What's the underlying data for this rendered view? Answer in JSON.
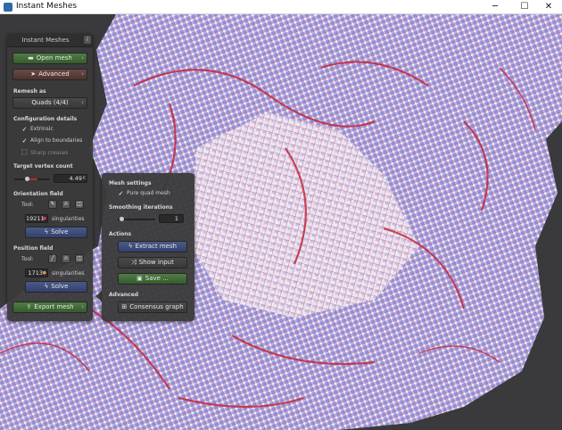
{
  "window": {
    "title": "Instant Meshes",
    "minimize": "─",
    "maximize": "☐",
    "close": "✕"
  },
  "panel": {
    "title": "Instant Meshes",
    "info": "i",
    "open_mesh": "Open mesh",
    "advanced": "Advanced",
    "remesh_as_label": "Remesh as",
    "remesh_as_value": "Quads (4/4)",
    "config_label": "Configuration details",
    "extrinsic": "Extrinsic",
    "align_boundaries": "Align to boundaries",
    "sharp_creases": "Sharp creases",
    "target_vertex_label": "Target vertex count",
    "target_vertex_value": "4.49",
    "target_vertex_unit": "K",
    "orientation_label": "Orientation field",
    "orientation_tool": "Tool:",
    "orientation_singularities": "19211",
    "orientation_singularities_label": "singularities",
    "orientation_solve": "Solve",
    "position_label": "Position field",
    "position_tool": "Tool:",
    "position_singularities": "1713",
    "position_singularities_label": "singularities",
    "position_solve": "Solve",
    "export_mesh": "Export mesh"
  },
  "popup": {
    "mesh_settings_label": "Mesh settings",
    "pure_quad": "Pure quad mesh",
    "smoothing_label": "Smoothing iterations",
    "smoothing_value": "1",
    "actions_label": "Actions",
    "extract_mesh": "Extract mesh",
    "show_input": "Show input",
    "save": "Save ...",
    "advanced_label": "Advanced",
    "consensus_graph": "Consensus graph"
  },
  "colors": {
    "mesh_fill": "#8a8ed8",
    "mesh_line": "#c0243c",
    "background": "#3a3a3c"
  }
}
